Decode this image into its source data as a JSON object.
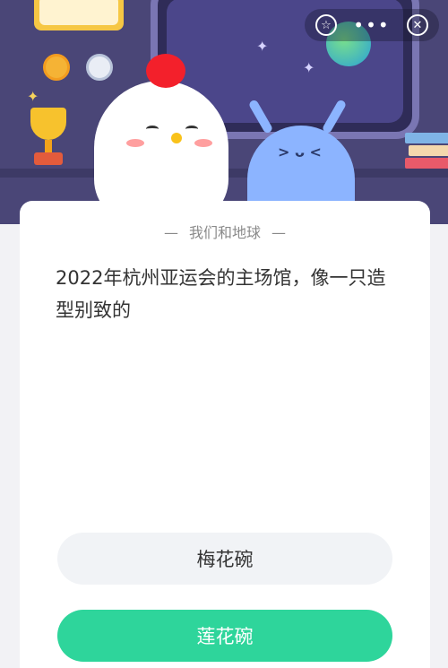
{
  "header": {
    "icons": [
      "star-icon",
      "more-icon",
      "close-icon"
    ],
    "more_symbol": "•••",
    "star_symbol": "☆",
    "close_symbol": "✕"
  },
  "quiz": {
    "category": "我们和地球",
    "question": "2022年杭州亚运会的主场馆，像一只造型别致的",
    "options": [
      "梅花碗",
      "莲花碗"
    ]
  },
  "colors": {
    "header_bg": "#4a4677",
    "option_selected": "#2ed59b",
    "option_default": "#f1f3f6"
  }
}
